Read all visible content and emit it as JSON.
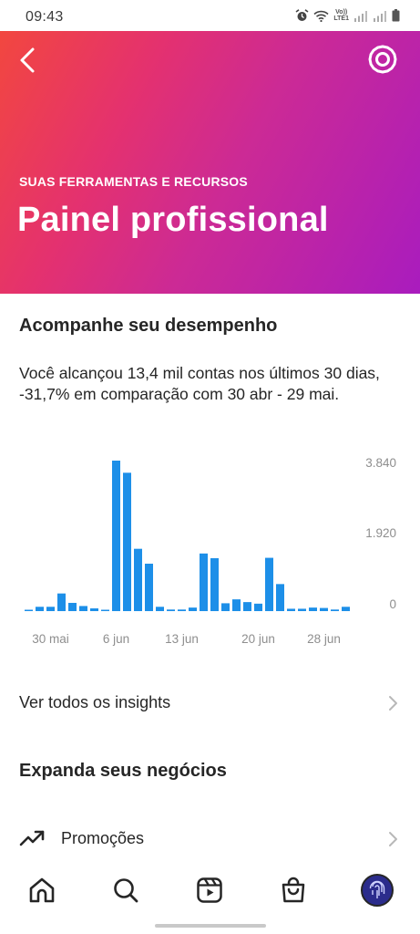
{
  "status_bar": {
    "time": "09:43",
    "icons": [
      "alarm-icon",
      "wifi-icon",
      "volte-icon",
      "signal-icon",
      "signal-icon",
      "battery-icon"
    ],
    "volte_label_top": "Vo))",
    "volte_label_bottom": "LTE1"
  },
  "header": {
    "back_icon": "chevron-left-icon",
    "settings_icon": "gear-icon",
    "kicker": "SUAS FERRAMENTAS E RECURSOS",
    "title": "Painel profissional",
    "gradient_colors": [
      "#f2473f",
      "#e4316f",
      "#cc2a95",
      "#a91cbe"
    ]
  },
  "performance": {
    "title": "Acompanhe seu desempenho",
    "summary": "Você alcançou 13,4 mil contas nos últimos 30 dias, -31,7% em comparação com 30 abr - 29 mai."
  },
  "chart_data": {
    "type": "bar",
    "color": "#1d8fe8",
    "y_ticks": [
      "3.840",
      "1.920",
      "0"
    ],
    "ylim": [
      0,
      3840
    ],
    "x_tick_labels": [
      "30 mai",
      "6 jun",
      "13 jun",
      "20 jun",
      "28 jun"
    ],
    "values": [
      20,
      110,
      110,
      450,
      210,
      130,
      70,
      30,
      3840,
      3530,
      1590,
      1210,
      110,
      40,
      40,
      90,
      1470,
      1350,
      200,
      300,
      230,
      190,
      1360,
      690,
      60,
      60,
      90,
      80,
      40,
      110
    ]
  },
  "links": {
    "insights_label": "Ver todos os insights",
    "chevron_icon": "chevron-right-icon"
  },
  "business": {
    "title": "Expanda seus negócios",
    "promotions_label": "Promoções",
    "promotions_icon": "trending-up-icon"
  },
  "bottom_nav": {
    "items": [
      "home-icon",
      "search-icon",
      "reels-icon",
      "shop-icon",
      "profile-avatar"
    ]
  }
}
